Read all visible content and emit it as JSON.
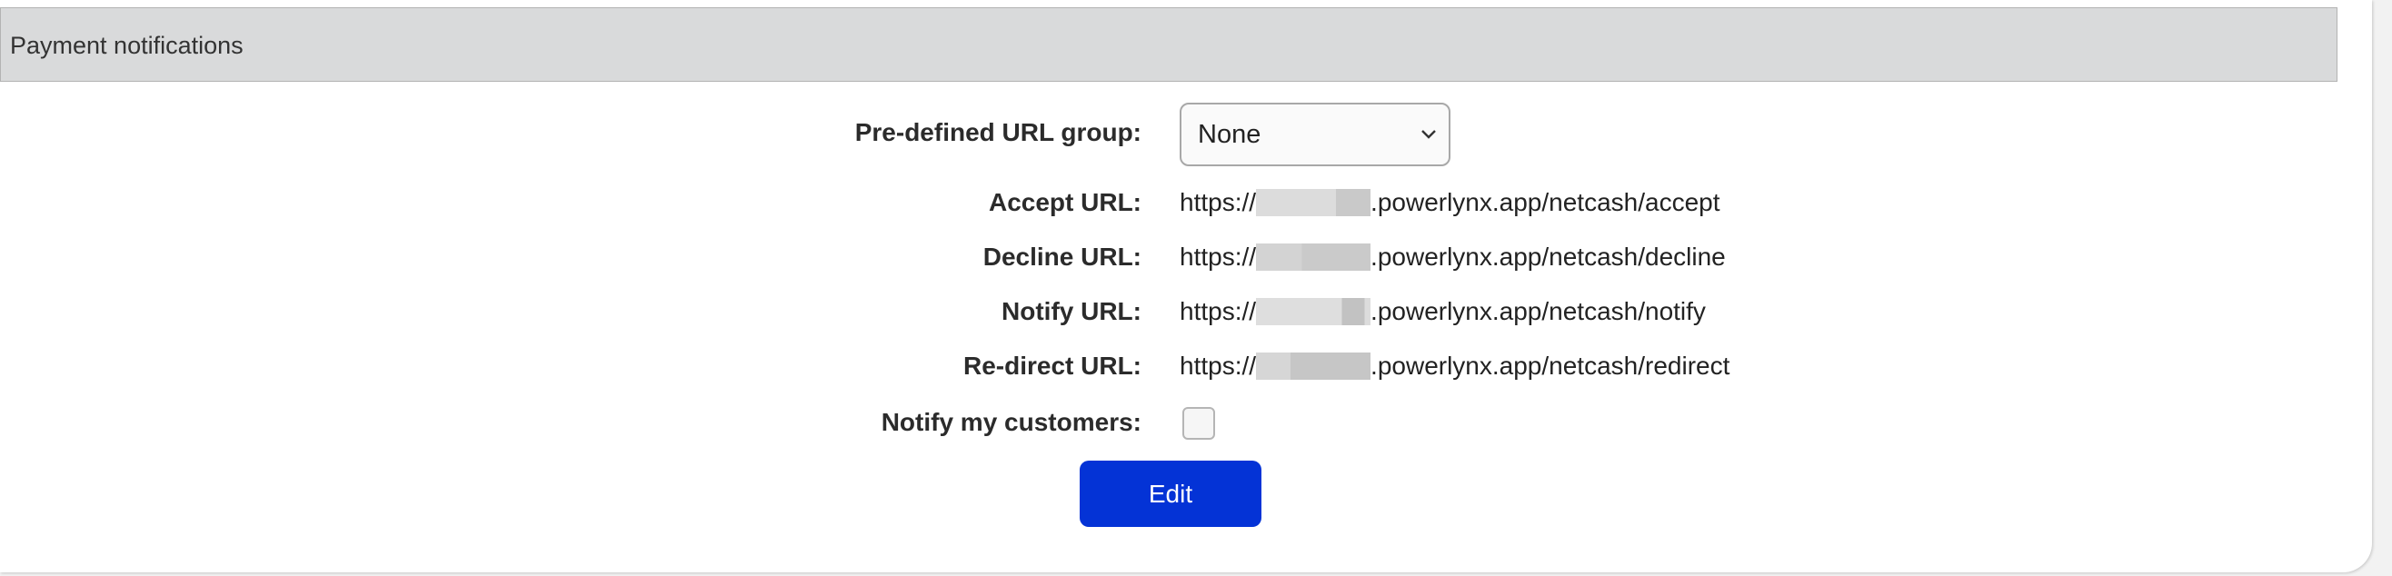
{
  "section": {
    "title": "Payment notifications"
  },
  "form": {
    "url_group": {
      "label": "Pre-defined URL group:",
      "value": "None"
    },
    "accept_url": {
      "label": "Accept URL:",
      "prefix": "https://",
      "suffix": ".powerlynx.app/netcash/accept"
    },
    "decline_url": {
      "label": "Decline URL:",
      "prefix": "https://",
      "suffix": ".powerlynx.app/netcash/decline"
    },
    "notify_url": {
      "label": "Notify URL:",
      "prefix": "https://",
      "suffix": ".powerlynx.app/netcash/notify"
    },
    "redirect_url": {
      "label": "Re-direct URL:",
      "prefix": "https://",
      "suffix": ".powerlynx.app/netcash/redirect"
    },
    "notify_customers": {
      "label": "Notify my customers:",
      "checked": false
    }
  },
  "actions": {
    "edit_label": "Edit"
  },
  "colors": {
    "button": "#0433d6",
    "header_bg": "#d9dadb"
  }
}
